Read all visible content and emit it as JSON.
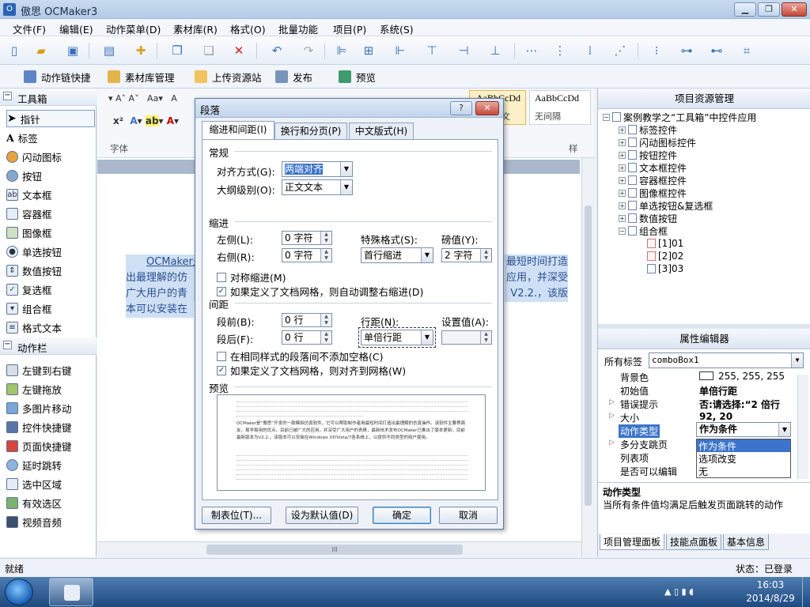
{
  "app": {
    "title": "傲思 OCMaker3",
    "icon_letter": "O"
  },
  "menu": [
    "文件(F)",
    "编辑(E)",
    "动作菜单(D)",
    "素材库(R)",
    "格式(O)",
    "批量功能",
    "项目(P)",
    "系统(S)"
  ],
  "toolbar2": {
    "action_shortcut": "动作链快捷",
    "asset_manager": "素材库管理",
    "upload": "上传资源站",
    "publish": "发布",
    "preview": "预览"
  },
  "toolbox": {
    "header": "工具箱",
    "items": [
      "指针",
      "标签",
      "闪动图标",
      "按钮",
      "文本框",
      "容器框",
      "图像框",
      "单选按钮",
      "数值按钮",
      "复选框",
      "组合框",
      "格式文本"
    ],
    "action_header": "动作栏",
    "actions": [
      "左键到右键",
      "左键拖放",
      "多图片移动",
      "控件快捷键",
      "页面快捷键",
      "延时跳转",
      "选中区域",
      "有效选区",
      "视频音频"
    ]
  },
  "document": {
    "ribbon_font_label": "字体",
    "ribbon_style_label": "样",
    "style_preview_1": "AaBbCcDd",
    "style_preview_2": "AaBbCcDd",
    "style_name_1": "文",
    "style_name_2": "无间隔",
    "text_lines": [
      "OCMaker是",
      "出最理解的仿",
      "广大用户的青",
      "本可以安装在"
    ],
    "text_right": [
      "最短时间打造",
      "应用，并深受",
      "V2.2.，该版"
    ],
    "hscroll_thumb": "III"
  },
  "dialog": {
    "title": "段落",
    "help": "?",
    "close": "✕",
    "tabs": [
      "缩进和间距(I)",
      "换行和分页(P)",
      "中文版式(H)"
    ],
    "general": {
      "section": "常规",
      "align_label": "对齐方式(G):",
      "align_value": "两端对齐",
      "outline_label": "大纲级别(O):",
      "outline_value": "正文文本"
    },
    "indent": {
      "section": "缩进",
      "left_label": "左侧(L):",
      "left_value": "0 字符",
      "right_label": "右侧(R):",
      "right_value": "0 字符",
      "special_label": "特殊格式(S):",
      "special_value": "首行缩进",
      "degree_label": "磅值(Y):",
      "degree_value": "2 字符",
      "mirror_label": "对称缩进(M)",
      "mirror_checked": false,
      "auto_adjust_label": "如果定义了文档网格，则自动调整右缩进(D)",
      "auto_adjust_checked": true
    },
    "spacing": {
      "section": "间距",
      "before_label": "段前(B):",
      "before_value": "0 行",
      "after_label": "段后(F):",
      "after_value": "0 行",
      "line_label": "行距(N):",
      "line_value": "单倍行距",
      "at_label": "设置值(A):",
      "at_value": "",
      "no_space_label": "在相同样式的段落间不添加空格(C)",
      "no_space_checked": false,
      "snap_label": "如果定义了文档网格，则对齐到网格(W)",
      "snap_checked": true
    },
    "preview": {
      "section": "预览",
      "sample": "OCMaker是“傲思”开发的一款模拟仿真软件，它可以帮助制作者用最短时间打造出最理解的仿真操作。该软件主要界面友，易学易用的优点，目前已被广大的应用，并深受广大用户的青睐，最新技术发布OCMaker已推出了版本更新，目前最新版本为V2.2.，该版本可以安装在Windows XP/Vista/7各系统上，以提供不同类型的用户使用。"
    },
    "buttons": {
      "tabs": "制表位(T)...",
      "default": "设为默认值(D)",
      "ok": "确定",
      "cancel": "取消"
    }
  },
  "project_panel": {
    "header": "项目资源管理",
    "root": "案例教学之“工具箱”中控件应用",
    "children": [
      "标签控件",
      "闪动图标控件",
      "按钮控件",
      "文本框控件",
      "容器框控件",
      "图像框控件",
      "单选按钮&复选框",
      "数值按钮",
      "组合框"
    ],
    "leaves": [
      "[1]01",
      "[2]02",
      "[3]03"
    ]
  },
  "property_editor": {
    "header": "属性编辑器",
    "all_tags_label": "所有标签",
    "selected_object": "comboBox1",
    "rows": [
      {
        "key": "背景色",
        "value": "255, 255, 255"
      },
      {
        "key": "初始值",
        "value": "单倍行距"
      },
      {
        "key": "错误提示",
        "value": "否:请选择:“2 倍行"
      },
      {
        "key": "大小",
        "value": "92, 20"
      },
      {
        "key": "动作类型",
        "value": "作为条件"
      },
      {
        "key": "多分支跳页",
        "value": ""
      },
      {
        "key": "列表项",
        "value": ""
      },
      {
        "key": "是否可以编辑",
        "value": ""
      }
    ],
    "dropdown_options": [
      "作为条件",
      "选项改变",
      "无"
    ],
    "desc_title": "动作类型",
    "desc_text": "当所有条件值均满足后触发页面跳转的动作",
    "tabs": [
      "项目管理面板",
      "技能点面板",
      "基本信息"
    ]
  },
  "status": {
    "left": "就绪",
    "right": "状态：已登录"
  },
  "taskbar": {
    "time": "16:03",
    "date": "2014/8/29"
  }
}
